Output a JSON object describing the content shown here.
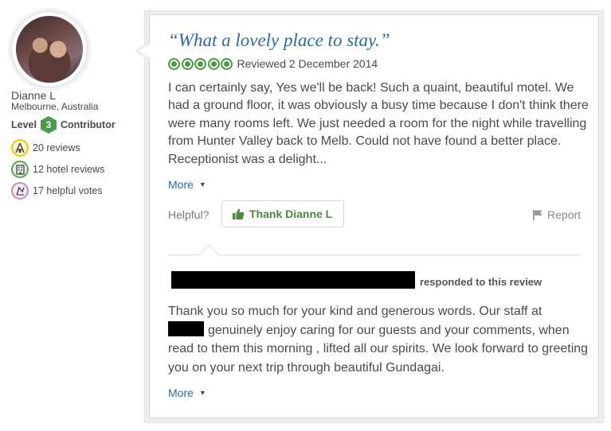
{
  "member": {
    "name": "Dianne L",
    "location": "Melbourne, Australia",
    "level_prefix": "Level",
    "level": "3",
    "level_suffix": "Contributor",
    "stats": {
      "reviews": "20 reviews",
      "hotel_reviews": "12 hotel reviews",
      "helpful_votes": "17 helpful votes"
    }
  },
  "review": {
    "title": "“What a lovely place to stay.”",
    "rating": 5,
    "rating_max": 5,
    "reviewed_date": "Reviewed 2 December 2014",
    "body": "I can certainly say, Yes we'll be back! Such a quaint, beautiful motel. We had a ground floor, it was obviously a busy time because I don't think there were many rooms left. We just needed a room for the night while travelling from Hunter Valley back to Melb. Could not have found a better place. Receptionist was a delight...",
    "more_label": "More",
    "helpful_label": "Helpful?",
    "thank_label": "Thank Dianne L",
    "report_label": "Report"
  },
  "response": {
    "responded_label": "responded to this review",
    "text_after_redaction": "genuinely enjoy caring for our guests and your comments, when read to them this morning , lifted all our spirits. We look forward to greeting you on your next trip through beautiful Gundagai.",
    "text_before_redaction": "Thank you so much for your kind and generous words. Our staff at",
    "more_label": "More"
  },
  "colors": {
    "accent_blue": "#2c6a9e",
    "rating_green": "#4a9b4a",
    "thank_green": "#4a8a3a"
  }
}
